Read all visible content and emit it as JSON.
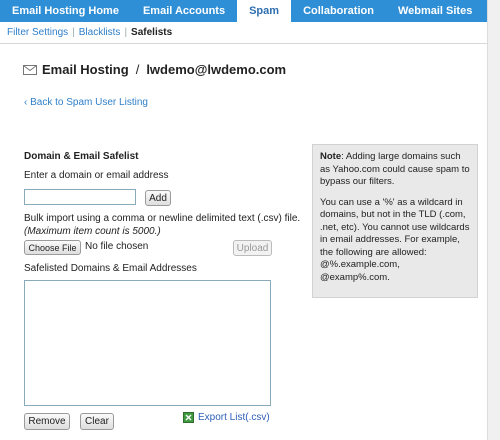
{
  "topnav": {
    "tabs": [
      {
        "label": "Email Hosting Home"
      },
      {
        "label": "Email Accounts"
      },
      {
        "label": "Spam"
      },
      {
        "label": "Collaboration"
      },
      {
        "label": "Webmail Sites"
      }
    ],
    "active_index": 2
  },
  "subnav": {
    "filter_settings": "Filter Settings",
    "blacklists": "Blacklists",
    "safelists": "Safelists",
    "separator": "|"
  },
  "header": {
    "section": "Email Hosting",
    "separator": "/",
    "account": "lwdemo@lwdemo.com",
    "icon": "envelope-icon"
  },
  "back_link": "‹ Back to Spam User Listing",
  "form": {
    "section_title": "Domain & Email Safelist",
    "enter_label": "Enter a domain or email address",
    "domain_input_value": "",
    "add_label": "Add",
    "bulk_label": "Bulk import using a comma or newline delimited text (.csv) file.",
    "max_note": "(Maximum item count is 5000.)",
    "choose_file_label": "Choose File",
    "no_file_text": "No file chosen",
    "upload_label": "Upload",
    "list_label": "Safelisted Domains & Email Addresses",
    "remove_label": "Remove",
    "clear_label": "Clear",
    "export_label": "Export List(.csv)",
    "export_icon": "spreadsheet-icon"
  },
  "note": {
    "heading": "Note",
    "para1": ": Adding large domains such as Yahoo.com could cause spam to bypass our filters.",
    "para2": "You can use a '%' as a wildcard in domains, but not in the TLD (.com, .net, etc). You cannot use wildcards in email addresses. For example, the following are allowed: @%.example.com, @examp%.com."
  },
  "colors": {
    "nav_blue": "#2f8fd6",
    "link_blue": "#2f7fc8",
    "note_bg": "#e9e9e9"
  }
}
